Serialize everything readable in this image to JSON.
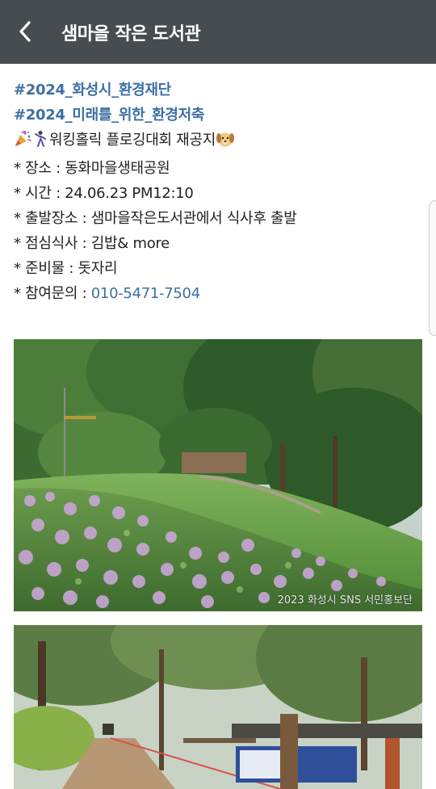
{
  "header": {
    "title": "샘마을 작은 도서관",
    "back_icon": "chevron-left-icon"
  },
  "post": {
    "hashtags": [
      "#2024_화성시_환경재단",
      "#2024_미래를_위한_환경저축"
    ],
    "headline": "워킹홀릭 플로깅대회 재공지",
    "headline_icons": [
      "party-popper-icon",
      "dancer-icon",
      "dog-face-icon"
    ],
    "details": [
      {
        "label": "* 장소 : ",
        "value": "동화마을생태공원"
      },
      {
        "label": "* 시간 : ",
        "value": "24.06.23 PM12:10"
      },
      {
        "label": "* 출발장소 : ",
        "value": "샘마을작은도서관에서 식사후 출발"
      },
      {
        "label": "* 점심식사 : ",
        "value": "김밥& more"
      },
      {
        "label": "* 준비물 : ",
        "value": "돗자리"
      },
      {
        "label": "* 참여문의 : ",
        "value": "010-5471-7504"
      }
    ],
    "link_color": "#3d6fa3"
  },
  "photos": [
    {
      "subject": "park with pink flowers and trees",
      "watermark": "2023 화성시 SNS 서민홍보단"
    },
    {
      "subject": "forest trail with banner and wooden shelter"
    }
  ],
  "colors": {
    "topbar": "#474c51",
    "hashtag": "#3d6fa3"
  }
}
